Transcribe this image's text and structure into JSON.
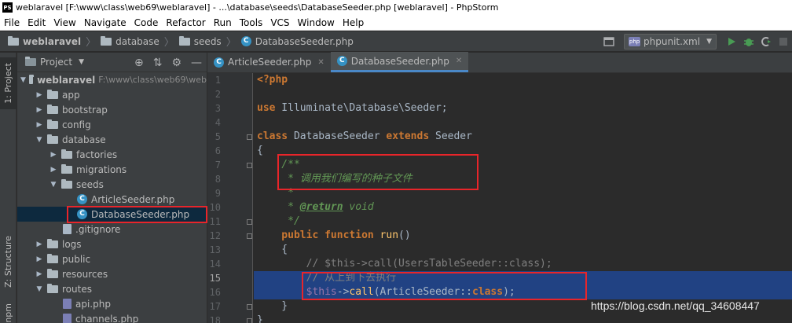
{
  "window": {
    "title": "weblaravel [F:\\www\\class\\web69\\weblaravel] - ...\\database\\seeds\\DatabaseSeeder.php [weblaravel] - PhpStorm",
    "logo": "PS"
  },
  "menu": [
    "File",
    "Edit",
    "View",
    "Navigate",
    "Code",
    "Refactor",
    "Run",
    "Tools",
    "VCS",
    "Window",
    "Help"
  ],
  "breadcrumb": [
    "weblaravel",
    "database",
    "seeds",
    "DatabaseSeeder.php"
  ],
  "run_config": "phpunit.xml",
  "stripe": {
    "project_tab": "1: Project",
    "structure_tab": "Z: Structure",
    "npm_tab": "npm"
  },
  "project_panel": {
    "title": "Project",
    "root_name": "weblaravel",
    "root_path": "F:\\www\\class\\web69\\web",
    "items": [
      {
        "label": "app"
      },
      {
        "label": "bootstrap"
      },
      {
        "label": "config"
      },
      {
        "label": "database"
      },
      {
        "label": "factories"
      },
      {
        "label": "migrations"
      },
      {
        "label": "seeds"
      },
      {
        "label": "ArticleSeeder.php"
      },
      {
        "label": "DatabaseSeeder.php"
      },
      {
        "label": ".gitignore"
      },
      {
        "label": "logs"
      },
      {
        "label": "public"
      },
      {
        "label": "resources"
      },
      {
        "label": "routes"
      },
      {
        "label": "api.php"
      },
      {
        "label": "channels.php"
      }
    ]
  },
  "tabs": [
    {
      "label": "ArticleSeeder.php"
    },
    {
      "label": "DatabaseSeeder.php"
    }
  ],
  "editor": {
    "line_numbers": [
      "1",
      "2",
      "3",
      "4",
      "5",
      "6",
      "7",
      "8",
      "9",
      "10",
      "11",
      "12",
      "13",
      "14",
      "15",
      "16",
      "17",
      "18"
    ],
    "l1": "<?php",
    "l3_kw": "use",
    "l3_rest": " Illuminate\\Database\\Seeder;",
    "l5_kw1": "class",
    "l5_mid": " DatabaseSeeder ",
    "l5_kw2": "extends",
    "l5_end": " Seeder",
    "l6": "{",
    "l7": "    /**",
    "l8": "     * 调用我们编写的种子文件",
    "l9": "     *",
    "l10_pre": "     * ",
    "l10_tag": "@return",
    "l10_post": " void",
    "l11": "     */",
    "l12_kw1": "    public",
    "l12_sp": " ",
    "l12_kw2": "function",
    "l12_fn": " run",
    "l12_end": "()",
    "l13": "    {",
    "l14": "        // $this->call(UsersTableSeeder::class);",
    "l15": "        // 从上到下去执行",
    "l16_var": "        $this",
    "l16_arrow": "->",
    "l16_fn": "call",
    "l16_mid": "(ArticleSeeder::",
    "l16_kw": "class",
    "l16_end": ");",
    "l17": "    }",
    "l18": "}"
  },
  "watermark": "https://blog.csdn.net/qq_34608447"
}
